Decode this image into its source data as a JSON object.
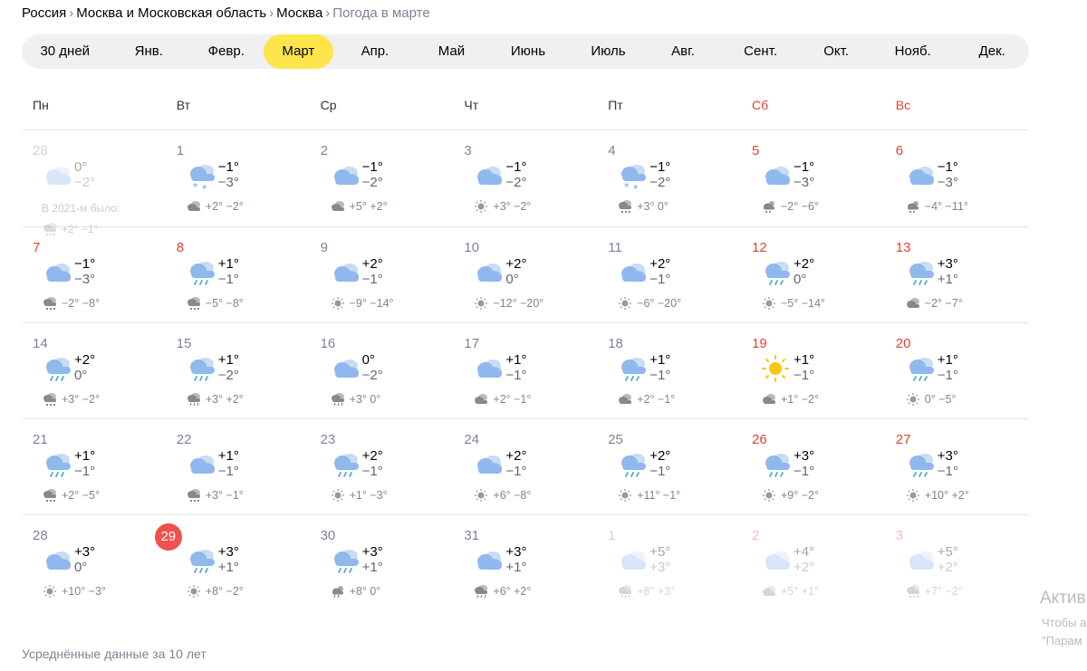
{
  "breadcrumb": {
    "items": [
      "Россия",
      "Москва и Московская область",
      "Москва"
    ],
    "current": "Погода в марте"
  },
  "tabs": [
    "30 дней",
    "Янв.",
    "Февр.",
    "Март",
    "Апр.",
    "Май",
    "Июнь",
    "Июль",
    "Авг.",
    "Сент.",
    "Окт.",
    "Нояб.",
    "Дек."
  ],
  "active_tab": "Март",
  "weekdays": [
    "Пн",
    "Вт",
    "Ср",
    "Чт",
    "Пт",
    "Сб",
    "Вс"
  ],
  "colors": {
    "accent": "#fde64b",
    "weekend": "#e8402f",
    "today": "#f1504c",
    "muted": "#7b8596"
  },
  "weeks": [
    [
      {
        "day": "28",
        "max": "0°",
        "min": "−2°",
        "icon": "cloud-icon",
        "hist": "",
        "hico": "",
        "faded": true,
        "note": "В 2021-м было:",
        "note_hist": "+2° −1°"
      },
      {
        "day": "1",
        "max": "−1°",
        "min": "−3°",
        "icon": "snow-cloud-icon",
        "hist": "+2° −2°",
        "hico": "cloudy-small-icon"
      },
      {
        "day": "2",
        "max": "−1°",
        "min": "−2°",
        "icon": "cloud-icon",
        "hist": "+5° +2°",
        "hico": "cloudy-small-icon"
      },
      {
        "day": "3",
        "max": "−1°",
        "min": "−2°",
        "icon": "cloud-icon",
        "hist": "+3° −2°",
        "hico": "sun-small-icon"
      },
      {
        "day": "4",
        "max": "−1°",
        "min": "−2°",
        "icon": "snow-cloud-icon",
        "hist": "+3° 0°",
        "hico": "snow-small-icon"
      },
      {
        "day": "5",
        "max": "−1°",
        "min": "−3°",
        "icon": "cloud-icon",
        "hist": "−2° −6°",
        "hico": "partly-snow-small-icon",
        "we": true
      },
      {
        "day": "6",
        "max": "−1°",
        "min": "−3°",
        "icon": "cloud-icon",
        "hist": "−4° −11°",
        "hico": "partly-snow-small-icon",
        "we": true
      }
    ],
    [
      {
        "day": "7",
        "max": "−1°",
        "min": "−3°",
        "icon": "cloud-icon",
        "hist": "−2° −8°",
        "hico": "snow-small-icon",
        "we": true
      },
      {
        "day": "8",
        "max": "+1°",
        "min": "−1°",
        "icon": "rain-cloud-icon",
        "hist": "−5° −8°",
        "hico": "snow-small-icon",
        "we": true
      },
      {
        "day": "9",
        "max": "+2°",
        "min": "−1°",
        "icon": "cloud-icon",
        "hist": "−9° −14°",
        "hico": "sun-small-icon"
      },
      {
        "day": "10",
        "max": "+2°",
        "min": "0°",
        "icon": "cloud-icon",
        "hist": "−12° −20°",
        "hico": "sun-small-icon"
      },
      {
        "day": "11",
        "max": "+2°",
        "min": "−1°",
        "icon": "cloud-icon",
        "hist": "−6° −20°",
        "hico": "sun-small-icon"
      },
      {
        "day": "12",
        "max": "+2°",
        "min": "0°",
        "icon": "rain-cloud-icon",
        "hist": "−5° −14°",
        "hico": "sun-small-icon",
        "we": true
      },
      {
        "day": "13",
        "max": "+3°",
        "min": "+1°",
        "icon": "rain-cloud-icon",
        "hist": "−2° −7°",
        "hico": "cloudy-small-icon",
        "we": true
      }
    ],
    [
      {
        "day": "14",
        "max": "+2°",
        "min": "0°",
        "icon": "rain-cloud-icon",
        "hist": "+3° −2°",
        "hico": "snow-small-icon"
      },
      {
        "day": "15",
        "max": "+1°",
        "min": "−2°",
        "icon": "rain-cloud-icon",
        "hist": "+3° +2°",
        "hico": "rain-small-icon"
      },
      {
        "day": "16",
        "max": "0°",
        "min": "−2°",
        "icon": "cloud-icon",
        "hist": "+3° 0°",
        "hico": "rain-small-icon"
      },
      {
        "day": "17",
        "max": "+1°",
        "min": "−1°",
        "icon": "cloud-icon",
        "hist": "+2° −1°",
        "hico": "cloudy-small-icon"
      },
      {
        "day": "18",
        "max": "+1°",
        "min": "−1°",
        "icon": "rain-cloud-icon",
        "hist": "+2° −1°",
        "hico": "cloudy-small-icon"
      },
      {
        "day": "19",
        "max": "+1°",
        "min": "−1°",
        "icon": "sun-icon",
        "hist": "+1° −2°",
        "hico": "cloudy-small-icon",
        "we": true
      },
      {
        "day": "20",
        "max": "+1°",
        "min": "−1°",
        "icon": "rain-cloud-icon",
        "hist": "0° −5°",
        "hico": "sun-small-icon",
        "we": true
      }
    ],
    [
      {
        "day": "21",
        "max": "+1°",
        "min": "−1°",
        "icon": "rain-cloud-icon",
        "hist": "+2° −5°",
        "hico": "snow-small-icon"
      },
      {
        "day": "22",
        "max": "+1°",
        "min": "−1°",
        "icon": "cloud-icon",
        "hist": "+3° −1°",
        "hico": "snow-small-icon"
      },
      {
        "day": "23",
        "max": "+2°",
        "min": "−1°",
        "icon": "rain-cloud-icon",
        "hist": "+1° −3°",
        "hico": "sun-small-icon"
      },
      {
        "day": "24",
        "max": "+2°",
        "min": "−1°",
        "icon": "cloud-icon",
        "hist": "+6° −8°",
        "hico": "sun-small-icon"
      },
      {
        "day": "25",
        "max": "+2°",
        "min": "−1°",
        "icon": "rain-cloud-icon",
        "hist": "+11° −1°",
        "hico": "sun-small-icon"
      },
      {
        "day": "26",
        "max": "+3°",
        "min": "−1°",
        "icon": "rain-cloud-icon",
        "hist": "+9° −2°",
        "hico": "sun-small-icon",
        "we": true
      },
      {
        "day": "27",
        "max": "+3°",
        "min": "−1°",
        "icon": "rain-cloud-icon",
        "hist": "+10° +2°",
        "hico": "sun-small-icon",
        "we": true
      }
    ],
    [
      {
        "day": "28",
        "max": "+3°",
        "min": "0°",
        "icon": "cloud-icon",
        "hist": "+10° −3°",
        "hico": "sun-small-icon"
      },
      {
        "day": "29",
        "max": "+3°",
        "min": "+1°",
        "icon": "rain-cloud-icon",
        "hist": "+8° −2°",
        "hico": "sun-small-icon",
        "today": true
      },
      {
        "day": "30",
        "max": "+3°",
        "min": "+1°",
        "icon": "rain-cloud-icon",
        "hist": "+8° 0°",
        "hico": "partly-rain-small-icon"
      },
      {
        "day": "31",
        "max": "+3°",
        "min": "+1°",
        "icon": "cloud-icon",
        "hist": "+6° +2°",
        "hico": "rain-small-icon"
      },
      {
        "day": "1",
        "max": "+5°",
        "min": "+3°",
        "icon": "cloud-icon",
        "hist": "+8° +3°",
        "hico": "rain-small-icon",
        "faded": true
      },
      {
        "day": "2",
        "max": "+4°",
        "min": "+2°",
        "icon": "cloud-icon",
        "hist": "+5° +1°",
        "hico": "cloudy-small-icon",
        "faded": true,
        "we": true
      },
      {
        "day": "3",
        "max": "+5°",
        "min": "+2°",
        "icon": "cloud-icon",
        "hist": "+7° −2°",
        "hico": "snow-small-icon",
        "faded": true,
        "we": true
      }
    ]
  ],
  "footer": "Усреднённые данные за 10 лет",
  "activation": {
    "title": "Актив",
    "line1": "Чтобы а",
    "line2": "\"Парам"
  }
}
